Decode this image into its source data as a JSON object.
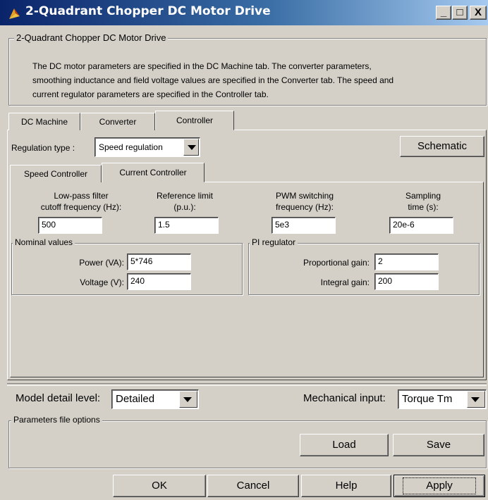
{
  "window": {
    "title": "2-Quadrant Chopper DC Motor Drive",
    "minimize": "_",
    "maximize": "□",
    "close": "X"
  },
  "block": {
    "name": "2-Quadrant Chopper DC Motor Drive",
    "description_lines": [
      "The DC motor parameters are specified in the DC Machine tab. The converter parameters,",
      "smoothing inductance and field voltage values are specified in the Converter tab. The speed and",
      "current regulator parameters are specified in the Controller tab."
    ]
  },
  "tabs": [
    "DC Machine",
    "Converter",
    "Controller"
  ],
  "active_tab": "Controller",
  "controller": {
    "regulation_type_label": "Regulation type :",
    "regulation_type_value": "Speed regulation",
    "schematic_button": "Schematic",
    "subtabs": [
      "Speed Controller",
      "Current Controller"
    ],
    "active_subtab": "Current Controller",
    "params": [
      {
        "label_line1": "Low-pass filter",
        "label_line2": "cutoff frequency (Hz):",
        "value": "500"
      },
      {
        "label_line1": "Reference limit",
        "label_line2": "(p.u.):",
        "value": "1.5"
      },
      {
        "label_line1": "PWM switching",
        "label_line2": "frequency (Hz):",
        "value": "5e3"
      },
      {
        "label_line1": "Sampling",
        "label_line2": "time (s):",
        "value": "20e-6"
      }
    ],
    "nominal": {
      "title": "Nominal values",
      "power_label": "Power (VA):",
      "power_value": "5*746",
      "voltage_label": "Voltage (V):",
      "voltage_value": "240"
    },
    "pi": {
      "title": "PI regulator",
      "kp_label": "Proportional gain:",
      "kp_value": "2",
      "ki_label": "Integral gain:",
      "ki_value": "200"
    }
  },
  "bottom": {
    "model_detail_label": "Model detail level:",
    "model_detail_value": "Detailed",
    "mech_input_label": "Mechanical input:",
    "mech_input_value": "Torque Tm",
    "params_file_title": "Parameters file options",
    "load_button": "Load",
    "save_button": "Save"
  },
  "dialog_buttons": {
    "ok": "OK",
    "cancel": "Cancel",
    "help": "Help",
    "apply": "Apply"
  }
}
